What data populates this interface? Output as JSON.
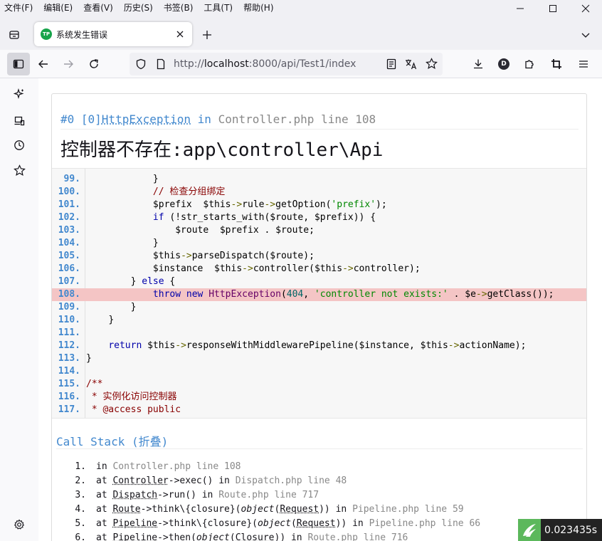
{
  "menu": [
    "文件(F)",
    "编辑(E)",
    "查看(V)",
    "历史(S)",
    "书签(B)",
    "工具(T)",
    "帮助(H)"
  ],
  "tab": {
    "title": "系统发生错误",
    "favicon_text": "TP"
  },
  "urlbar": {
    "scheme": "http://",
    "host": "localhost",
    "path": ":8000/api/Test1/index"
  },
  "exception": {
    "number": "#0 [0]",
    "class": "HttpException",
    "in_word": "in",
    "file": "Controller.php line 108",
    "message": "控制器不存在:app\\controller\\Api"
  },
  "source": {
    "lines": [
      {
        "n": "99.",
        "code": "            }"
      },
      {
        "n": "100.",
        "code": "            // 检查分组绑定"
      },
      {
        "n": "101.",
        "code": "            $prefix = $this->rule->getOption('prefix');"
      },
      {
        "n": "102.",
        "code": "            if (!str_starts_with($route, $prefix)) {"
      },
      {
        "n": "103.",
        "code": "                $route = $prefix . $route;"
      },
      {
        "n": "104.",
        "code": "            }"
      },
      {
        "n": "105.",
        "code": "            $this->parseDispatch($route);"
      },
      {
        "n": "106.",
        "code": "            $instance = $this->controller($this->controller);"
      },
      {
        "n": "107.",
        "code": "        } else {"
      },
      {
        "n": "108.",
        "code": "            throw new HttpException(404, 'controller not exists:' . $e->getClass());",
        "highlight": true
      },
      {
        "n": "109.",
        "code": "        }"
      },
      {
        "n": "110.",
        "code": "    }"
      },
      {
        "n": "111.",
        "code": ""
      },
      {
        "n": "112.",
        "code": "    return $this->responseWithMiddlewarePipeline($instance, $this->actionName);"
      },
      {
        "n": "113.",
        "code": "}"
      },
      {
        "n": "114.",
        "code": ""
      },
      {
        "n": "115.",
        "code": "/**"
      },
      {
        "n": "116.",
        "code": " * 实例化访问控制器"
      },
      {
        "n": "117.",
        "code": " * @access public"
      }
    ]
  },
  "call_stack": {
    "title": "Call Stack (折叠)",
    "items": [
      {
        "idx": "1.",
        "text": "in Controller.php line 108"
      },
      {
        "idx": "2.",
        "text": "at Controller->exec() in Dispatch.php line 48"
      },
      {
        "idx": "3.",
        "text": "at Dispatch->run() in Route.php line 717"
      },
      {
        "idx": "4.",
        "text": "at Route->think\\{closure}(object(Request)) in Pipeline.php line 59"
      },
      {
        "idx": "5.",
        "text": "at Pipeline->think\\{closure}(object(Request)) in Pipeline.php line 66"
      },
      {
        "idx": "6.",
        "text": "at Pipeline->then(object(Closure)) in Route.php line 716"
      }
    ]
  },
  "timer": {
    "value": "0.023435s"
  },
  "colors": {
    "accent": "#4288ce",
    "highlight": "#f4c5c5",
    "timer_bg": "#232323",
    "timer_logo": "#5cb85c"
  }
}
